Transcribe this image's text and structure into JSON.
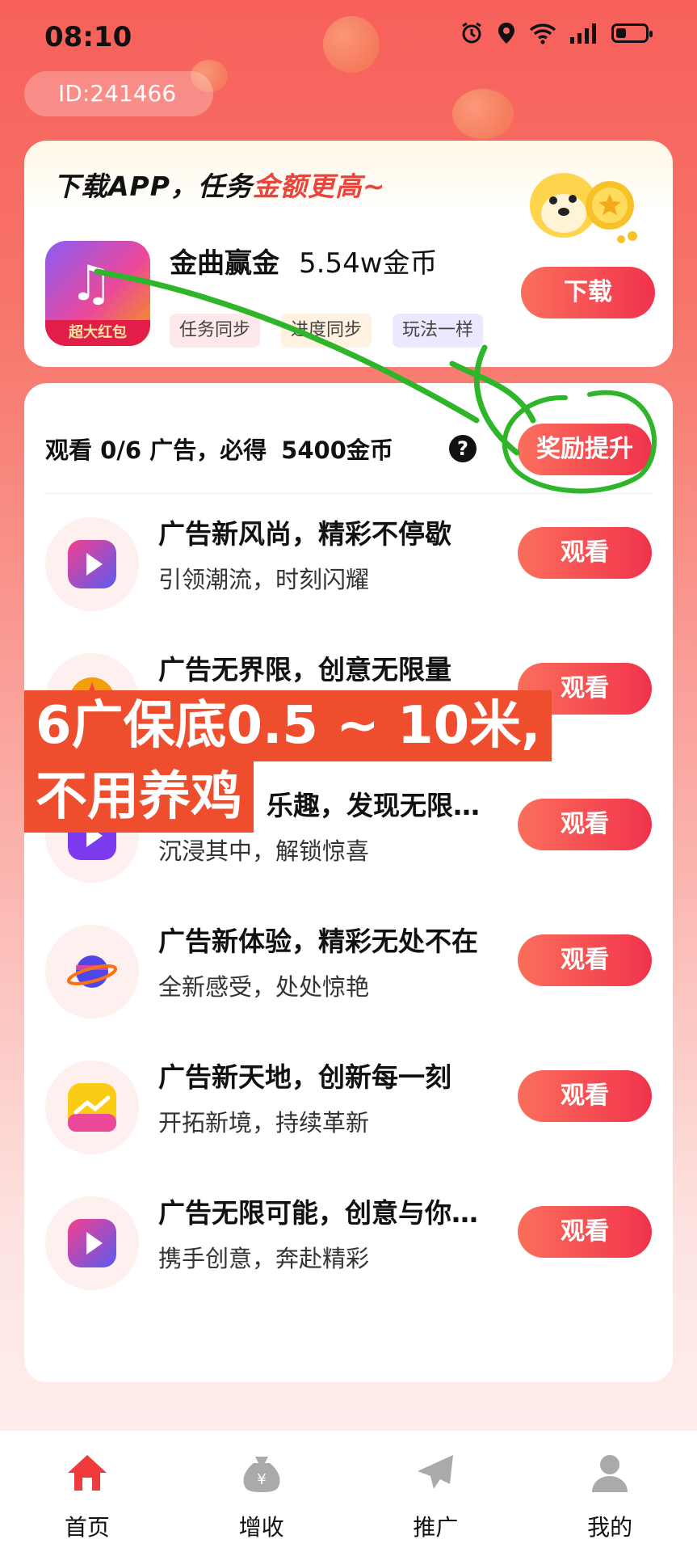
{
  "status_bar": {
    "time": "08:10"
  },
  "user": {
    "id_label": "ID:241466"
  },
  "download_card": {
    "promo_prefix": "下载APP，任务",
    "promo_highlight": "金额更高~",
    "app_name": "金曲赢金",
    "app_coins": "5.54w金币",
    "app_badge": "超大红包",
    "tags": [
      "任务同步",
      "进度同步",
      "玩法一样"
    ],
    "download_label": "下载"
  },
  "task_card": {
    "summary": "观看 0/6 广告，必得",
    "reward": "5400金币",
    "help_icon": "?",
    "boost_label": "奖励提升",
    "items": [
      {
        "title": "广告新风尚，精彩不停歇",
        "subtitle": "引领潮流，时刻闪耀",
        "button": "观看",
        "icon": "play-icon"
      },
      {
        "title": "广告无界限，创意无限量",
        "subtitle": "",
        "button": "观看",
        "icon": "compass-icon"
      },
      {
        "title": "乐趣，发现无限…",
        "subtitle": "沉浸其中，解锁惊喜",
        "button": "观看",
        "icon": "play-icon"
      },
      {
        "title": "广告新体验，精彩无处不在",
        "subtitle": "全新感受，处处惊艳",
        "button": "观看",
        "icon": "planet-icon"
      },
      {
        "title": "广告新天地，创新每一刻",
        "subtitle": "开拓新境，持续革新",
        "button": "观看",
        "icon": "chart-icon"
      },
      {
        "title": "广告无限可能，创意与你…",
        "subtitle": "携手创意，奔赴精彩",
        "button": "观看",
        "icon": "play-icon"
      }
    ]
  },
  "overlay": {
    "line1": "6广保底0.5 ~ 10米,",
    "line2": "不用养鸡"
  },
  "bottom_nav": [
    {
      "label": "首页",
      "icon": "home-icon",
      "active": true
    },
    {
      "label": "增收",
      "icon": "money-bag-icon",
      "active": false
    },
    {
      "label": "推广",
      "icon": "paper-plane-icon",
      "active": false
    },
    {
      "label": "我的",
      "icon": "user-icon",
      "active": false
    }
  ],
  "colors": {
    "accent": "#f0334c",
    "accent_light": "#fb6f5b",
    "overlay": "#ef4e2e",
    "annotation": "#2fb52a"
  }
}
